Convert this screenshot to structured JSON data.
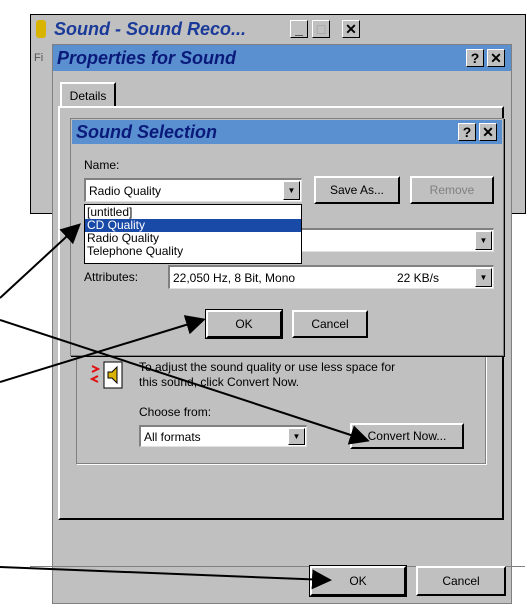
{
  "sound_recorder": {
    "title": "Sound - Sound Reco...",
    "menu_partial": "Fi"
  },
  "properties": {
    "title": "Properties for Sound",
    "tab": "Details",
    "convert_text_line1": "To adjust the sound quality or use less space for",
    "convert_text_line2": "this sound, click Convert Now.",
    "choose_from_label": "Choose from:",
    "choose_from_value": "All formats",
    "convert_now_button": "Convert Now...",
    "ok_button": "OK",
    "cancel_button": "Cancel",
    "help_glyph": "?",
    "close_glyph": "✕"
  },
  "sound_selection": {
    "title": "Sound Selection",
    "name_label": "Name:",
    "name_value": "Radio Quality",
    "save_as_button": "Save As...",
    "remove_button": "Remove",
    "dropdown_options": [
      "[untitled]",
      "CD Quality",
      "Radio Quality",
      "Telephone Quality"
    ],
    "selected_option_index": 1,
    "attributes_label": "Attributes:",
    "attributes_value": "22,050 Hz, 8 Bit, Mono",
    "attributes_rate": "22 KB/s",
    "ok_button": "OK",
    "cancel_button": "Cancel"
  },
  "colors": {
    "titlebar": "#5a8fd0",
    "highlight": "#1a4aa8",
    "face": "#c0c0c0"
  }
}
